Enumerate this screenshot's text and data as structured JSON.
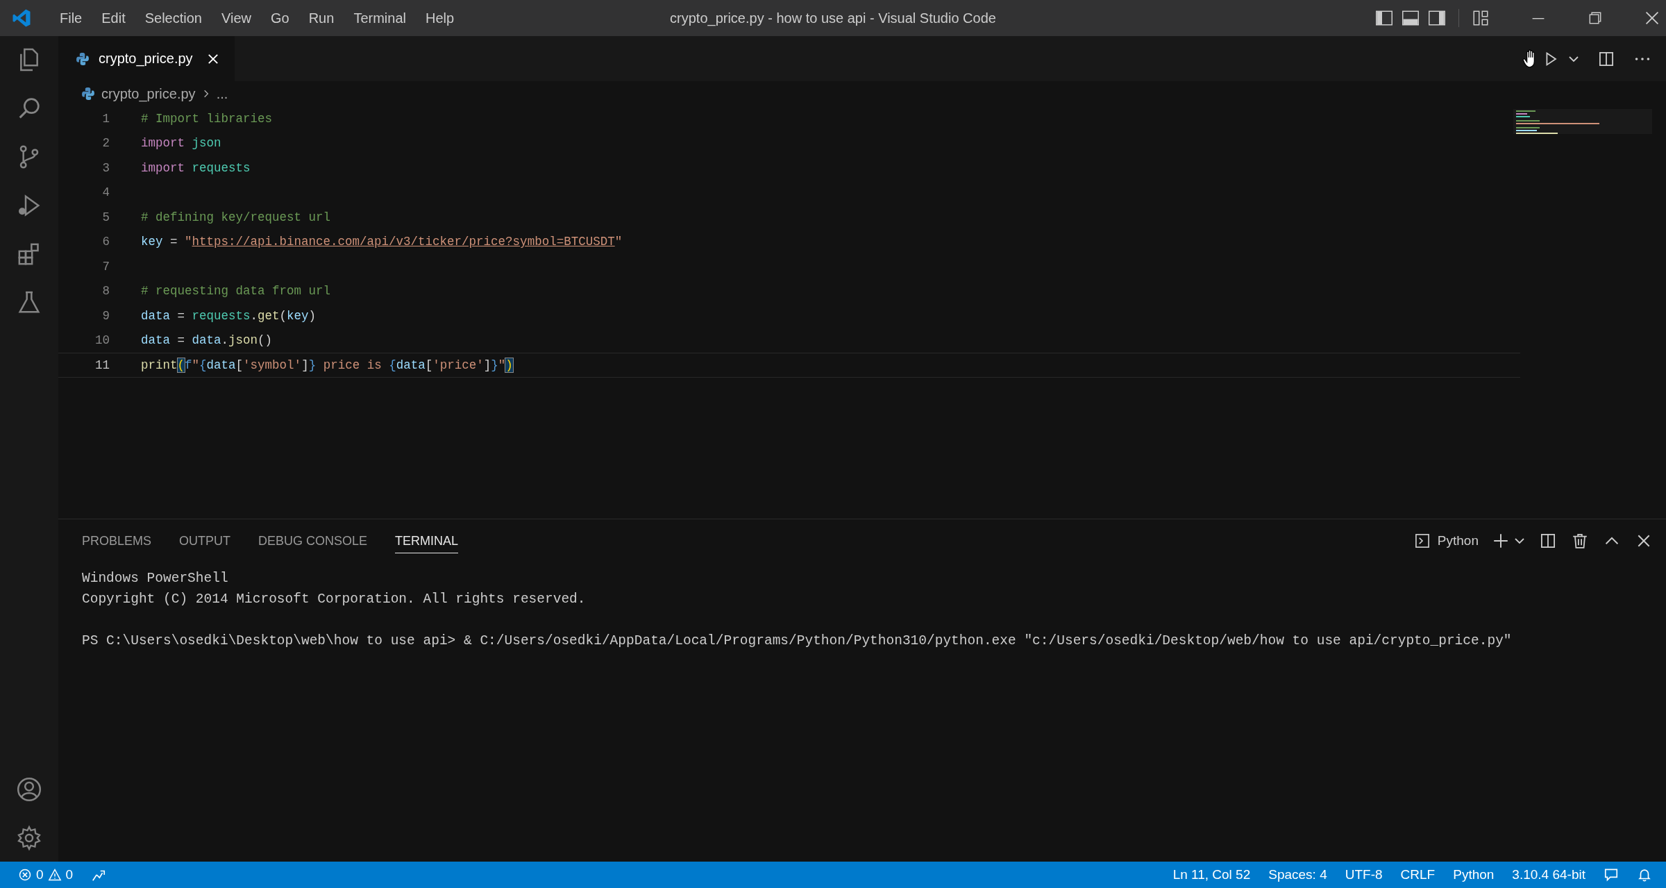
{
  "window": {
    "title": "crypto_price.py - how to use api - Visual Studio Code"
  },
  "menu": [
    "File",
    "Edit",
    "Selection",
    "View",
    "Go",
    "Run",
    "Terminal",
    "Help"
  ],
  "tabs": [
    {
      "label": "crypto_price.py",
      "selected": true
    }
  ],
  "breadcrumb": {
    "file": "crypto_price.py",
    "more": "..."
  },
  "editor": {
    "lines": [
      {
        "number": "1",
        "current": false,
        "tokens": [
          {
            "kind": "comment",
            "text": "# Import libraries"
          }
        ]
      },
      {
        "number": "2",
        "current": false,
        "tokens": [
          {
            "kind": "keyword",
            "text": "import "
          },
          {
            "kind": "module",
            "text": "json"
          }
        ]
      },
      {
        "number": "3",
        "current": false,
        "tokens": [
          {
            "kind": "keyword",
            "text": "import "
          },
          {
            "kind": "module",
            "text": "requests"
          }
        ]
      },
      {
        "number": "4",
        "current": false
      },
      {
        "number": "5",
        "current": false,
        "tokens": [
          {
            "kind": "comment",
            "text": "# defining key/request url"
          }
        ]
      },
      {
        "number": "6",
        "current": false,
        "tokens": [
          {
            "kind": "variable",
            "text": "key"
          },
          {
            "kind": "plain",
            "text": " = "
          },
          {
            "kind": "string",
            "text": "\""
          },
          {
            "kind": "link",
            "text": "https://api.binance.com/api/v3/ticker/price?symbol=BTCUSDT"
          },
          {
            "kind": "string",
            "text": "\""
          }
        ]
      },
      {
        "number": "7",
        "current": false
      },
      {
        "number": "8",
        "current": false,
        "tokens": [
          {
            "kind": "comment",
            "text": "# requesting data from url"
          }
        ]
      },
      {
        "number": "9",
        "current": false,
        "tokens": [
          {
            "kind": "variable",
            "text": "data"
          },
          {
            "kind": "plain",
            "text": " = "
          },
          {
            "kind": "module",
            "text": "requests"
          },
          {
            "kind": "plain",
            "text": "."
          },
          {
            "kind": "function",
            "text": "get"
          },
          {
            "kind": "plain",
            "text": "("
          },
          {
            "kind": "variable",
            "text": "key"
          },
          {
            "kind": "plain",
            "text": ")"
          }
        ]
      },
      {
        "number": "10",
        "current": false,
        "tokens": [
          {
            "kind": "variable",
            "text": "data"
          },
          {
            "kind": "plain",
            "text": " = "
          },
          {
            "kind": "variable",
            "text": "data"
          },
          {
            "kind": "plain",
            "text": "."
          },
          {
            "kind": "function",
            "text": "json"
          },
          {
            "kind": "plain",
            "text": "()"
          }
        ]
      },
      {
        "number": "11",
        "current": true,
        "tokens": [
          {
            "kind": "function",
            "text": "print"
          },
          {
            "kind": "match",
            "text": "("
          },
          {
            "kind": "brace",
            "text": "f"
          },
          {
            "kind": "string",
            "text": "\""
          },
          {
            "kind": "brace",
            "text": "{"
          },
          {
            "kind": "variable",
            "text": "data"
          },
          {
            "kind": "plain",
            "text": "["
          },
          {
            "kind": "string",
            "text": "'symbol'"
          },
          {
            "kind": "plain",
            "text": "]"
          },
          {
            "kind": "brace",
            "text": "}"
          },
          {
            "kind": "string",
            "text": " price is "
          },
          {
            "kind": "brace",
            "text": "{"
          },
          {
            "kind": "variable",
            "text": "data"
          },
          {
            "kind": "plain",
            "text": "["
          },
          {
            "kind": "string",
            "text": "'price'"
          },
          {
            "kind": "plain",
            "text": "]"
          },
          {
            "kind": "brace",
            "text": "}"
          },
          {
            "kind": "string",
            "text": "\""
          },
          {
            "kind": "match",
            "text": ")"
          }
        ]
      }
    ]
  },
  "panel": {
    "tabs": [
      {
        "label": "PROBLEMS",
        "selected": false
      },
      {
        "label": "OUTPUT",
        "selected": false
      },
      {
        "label": "DEBUG CONSOLE",
        "selected": false
      },
      {
        "label": "TERMINAL",
        "selected": true
      }
    ],
    "terminal_profile": "Python",
    "banner": [
      "Windows PowerShell",
      "Copyright (C) 2014 Microsoft Corporation. All rights reserved."
    ],
    "command": "PS C:\\Users\\osedki\\Desktop\\web\\how to use api> & C:/Users/osedki/AppData/Local/Programs/Python/Python310/python.exe \"c:/Users/osedki/Desktop/web/how to use api/crypto_price.py\""
  },
  "status_bar": {
    "errors": "0",
    "warnings": "0",
    "items": [
      "Ln 11, Col 52",
      "Spaces: 4",
      "UTF-8",
      "CRLF",
      "Python",
      "3.10.4 64-bit"
    ]
  }
}
